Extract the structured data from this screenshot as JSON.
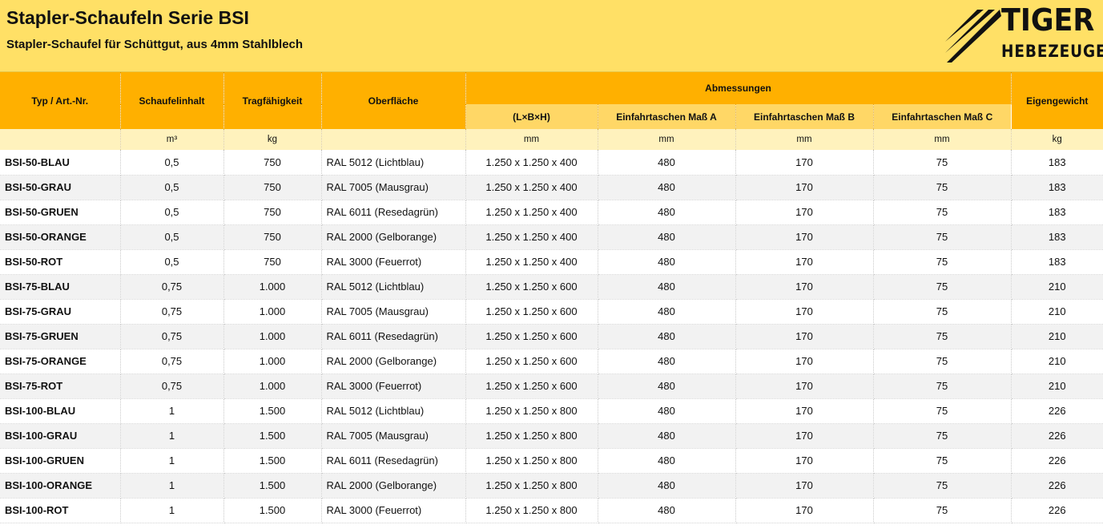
{
  "header": {
    "title": "Stapler-Schaufeln Serie BSI",
    "subtitle": "Stapler-Schaufel für Schüttgut, aus 4mm Stahlblech",
    "logo_line1": "TIGER",
    "logo_line2": "HEBEZEUGE"
  },
  "table": {
    "col_typ": "Typ / Art.-Nr.",
    "col_inhalt": "Schaufelinhalt",
    "col_trag": "Tragfähigkeit",
    "col_oberflaeche": "Oberfläche",
    "group_abm": "Abmessungen",
    "col_lbh": "(L×B×H)",
    "col_a": "Einfahrtaschen Maß A",
    "col_b": "Einfahrtaschen Maß B",
    "col_c": "Einfahrtaschen Maß C",
    "col_gewicht": "Eigengewicht",
    "units": {
      "typ": "",
      "inhalt": "m³",
      "trag": "kg",
      "oberflaeche": "",
      "lbh": "mm",
      "a": "mm",
      "b": "mm",
      "c": "mm",
      "gewicht": "kg"
    },
    "rows": [
      {
        "typ": "BSI-50-BLAU",
        "inhalt": "0,5",
        "trag": "750",
        "oberflaeche": "RAL 5012 (Lichtblau)",
        "lbh": "1.250 x 1.250 x 400",
        "a": "480",
        "b": "170",
        "c": "75",
        "gewicht": "183"
      },
      {
        "typ": "BSI-50-GRAU",
        "inhalt": "0,5",
        "trag": "750",
        "oberflaeche": "RAL 7005 (Mausgrau)",
        "lbh": "1.250 x 1.250 x 400",
        "a": "480",
        "b": "170",
        "c": "75",
        "gewicht": "183"
      },
      {
        "typ": "BSI-50-GRUEN",
        "inhalt": "0,5",
        "trag": "750",
        "oberflaeche": "RAL 6011 (Resedagrün)",
        "lbh": "1.250 x 1.250 x 400",
        "a": "480",
        "b": "170",
        "c": "75",
        "gewicht": "183"
      },
      {
        "typ": "BSI-50-ORANGE",
        "inhalt": "0,5",
        "trag": "750",
        "oberflaeche": "RAL 2000 (Gelborange)",
        "lbh": "1.250 x 1.250 x 400",
        "a": "480",
        "b": "170",
        "c": "75",
        "gewicht": "183"
      },
      {
        "typ": "BSI-50-ROT",
        "inhalt": "0,5",
        "trag": "750",
        "oberflaeche": "RAL 3000 (Feuerrot)",
        "lbh": "1.250 x 1.250 x 400",
        "a": "480",
        "b": "170",
        "c": "75",
        "gewicht": "183"
      },
      {
        "typ": "BSI-75-BLAU",
        "inhalt": "0,75",
        "trag": "1.000",
        "oberflaeche": "RAL 5012 (Lichtblau)",
        "lbh": "1.250 x 1.250 x 600",
        "a": "480",
        "b": "170",
        "c": "75",
        "gewicht": "210"
      },
      {
        "typ": "BSI-75-GRAU",
        "inhalt": "0,75",
        "trag": "1.000",
        "oberflaeche": "RAL 7005 (Mausgrau)",
        "lbh": "1.250 x 1.250 x 600",
        "a": "480",
        "b": "170",
        "c": "75",
        "gewicht": "210"
      },
      {
        "typ": "BSI-75-GRUEN",
        "inhalt": "0,75",
        "trag": "1.000",
        "oberflaeche": "RAL 6011 (Resedagrün)",
        "lbh": "1.250 x 1.250 x 600",
        "a": "480",
        "b": "170",
        "c": "75",
        "gewicht": "210"
      },
      {
        "typ": "BSI-75-ORANGE",
        "inhalt": "0,75",
        "trag": "1.000",
        "oberflaeche": "RAL 2000 (Gelborange)",
        "lbh": "1.250 x 1.250 x 600",
        "a": "480",
        "b": "170",
        "c": "75",
        "gewicht": "210"
      },
      {
        "typ": "BSI-75-ROT",
        "inhalt": "0,75",
        "trag": "1.000",
        "oberflaeche": "RAL 3000 (Feuerrot)",
        "lbh": "1.250 x 1.250 x 600",
        "a": "480",
        "b": "170",
        "c": "75",
        "gewicht": "210"
      },
      {
        "typ": "BSI-100-BLAU",
        "inhalt": "1",
        "trag": "1.500",
        "oberflaeche": "RAL 5012 (Lichtblau)",
        "lbh": "1.250 x 1.250 x 800",
        "a": "480",
        "b": "170",
        "c": "75",
        "gewicht": "226"
      },
      {
        "typ": "BSI-100-GRAU",
        "inhalt": "1",
        "trag": "1.500",
        "oberflaeche": "RAL 7005 (Mausgrau)",
        "lbh": "1.250 x 1.250 x 800",
        "a": "480",
        "b": "170",
        "c": "75",
        "gewicht": "226"
      },
      {
        "typ": "BSI-100-GRUEN",
        "inhalt": "1",
        "trag": "1.500",
        "oberflaeche": "RAL 6011 (Resedagrün)",
        "lbh": "1.250 x 1.250 x 800",
        "a": "480",
        "b": "170",
        "c": "75",
        "gewicht": "226"
      },
      {
        "typ": "BSI-100-ORANGE",
        "inhalt": "1",
        "trag": "1.500",
        "oberflaeche": "RAL 2000 (Gelborange)",
        "lbh": "1.250 x 1.250 x 800",
        "a": "480",
        "b": "170",
        "c": "75",
        "gewicht": "226"
      },
      {
        "typ": "BSI-100-ROT",
        "inhalt": "1",
        "trag": "1.500",
        "oberflaeche": "RAL 3000 (Feuerrot)",
        "lbh": "1.250 x 1.250 x 800",
        "a": "480",
        "b": "170",
        "c": "75",
        "gewicht": "226"
      }
    ]
  },
  "colors": {
    "banner": "#ffe066",
    "header": "#ffb000",
    "subheader": "#ffd766",
    "units_row": "#fff2bd",
    "stripe": "#f2f2f2"
  }
}
